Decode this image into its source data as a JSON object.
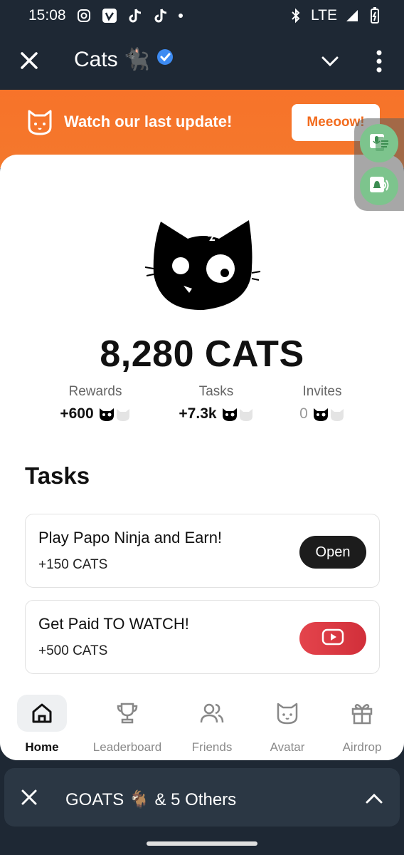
{
  "status": {
    "time": "15:08",
    "network": "LTE"
  },
  "header": {
    "title": "Cats",
    "title_emoji": "🐈‍⬛"
  },
  "banner": {
    "text": "Watch our last update!",
    "button": "Meeoow!"
  },
  "balance": "8,280 CATS",
  "stats": [
    {
      "label": "Rewards",
      "value": "+600"
    },
    {
      "label": "Tasks",
      "value": "+7.3k"
    },
    {
      "label": "Invites",
      "value": "0"
    }
  ],
  "tasks_title": "Tasks",
  "tasks": [
    {
      "name": "Play Papo Ninja and Earn!",
      "reward": "+150 CATS",
      "button": "Open"
    },
    {
      "name": "Get Paid TO WATCH!",
      "reward": "+500 CATS"
    }
  ],
  "nav": [
    {
      "label": "Home",
      "icon": "home-icon"
    },
    {
      "label": "Leaderboard",
      "icon": "trophy-icon"
    },
    {
      "label": "Friends",
      "icon": "friends-icon"
    },
    {
      "label": "Avatar",
      "icon": "cat-face-icon"
    },
    {
      "label": "Airdrop",
      "icon": "gift-icon"
    }
  ],
  "others_bar": {
    "text": "GOATS 🐐 & 5 Others"
  },
  "colors": {
    "accent": "#f7732a",
    "dark": "#1e2834"
  }
}
